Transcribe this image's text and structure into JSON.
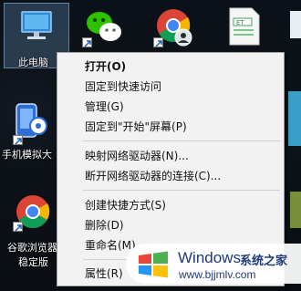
{
  "desktop": {
    "icons": {
      "this_pc": {
        "label": "此电脑"
      },
      "phone_sim": {
        "label": "手机模拟大"
      },
      "chrome_browser": {
        "label_line1": "谷歌浏览器",
        "label_line2": "稳定版"
      }
    }
  },
  "context_menu": {
    "items": [
      {
        "label": "打开(O)"
      },
      {
        "label": "固定到快速访问"
      },
      {
        "label": "管理(G)"
      },
      {
        "label": "固定到\"开始\"屏幕(P)"
      },
      {
        "label": "映射网络驱动器(N)..."
      },
      {
        "label": "断开网络驱动器的连接(C)..."
      },
      {
        "label": "创建快捷方式(S)"
      },
      {
        "label": "删除(D)"
      },
      {
        "label": "重命名(M)"
      },
      {
        "label": "属性(R)"
      }
    ]
  },
  "watermark": {
    "brand": "Windows",
    "suffix": "系统之家",
    "url": "www.bjjmlv.com"
  }
}
